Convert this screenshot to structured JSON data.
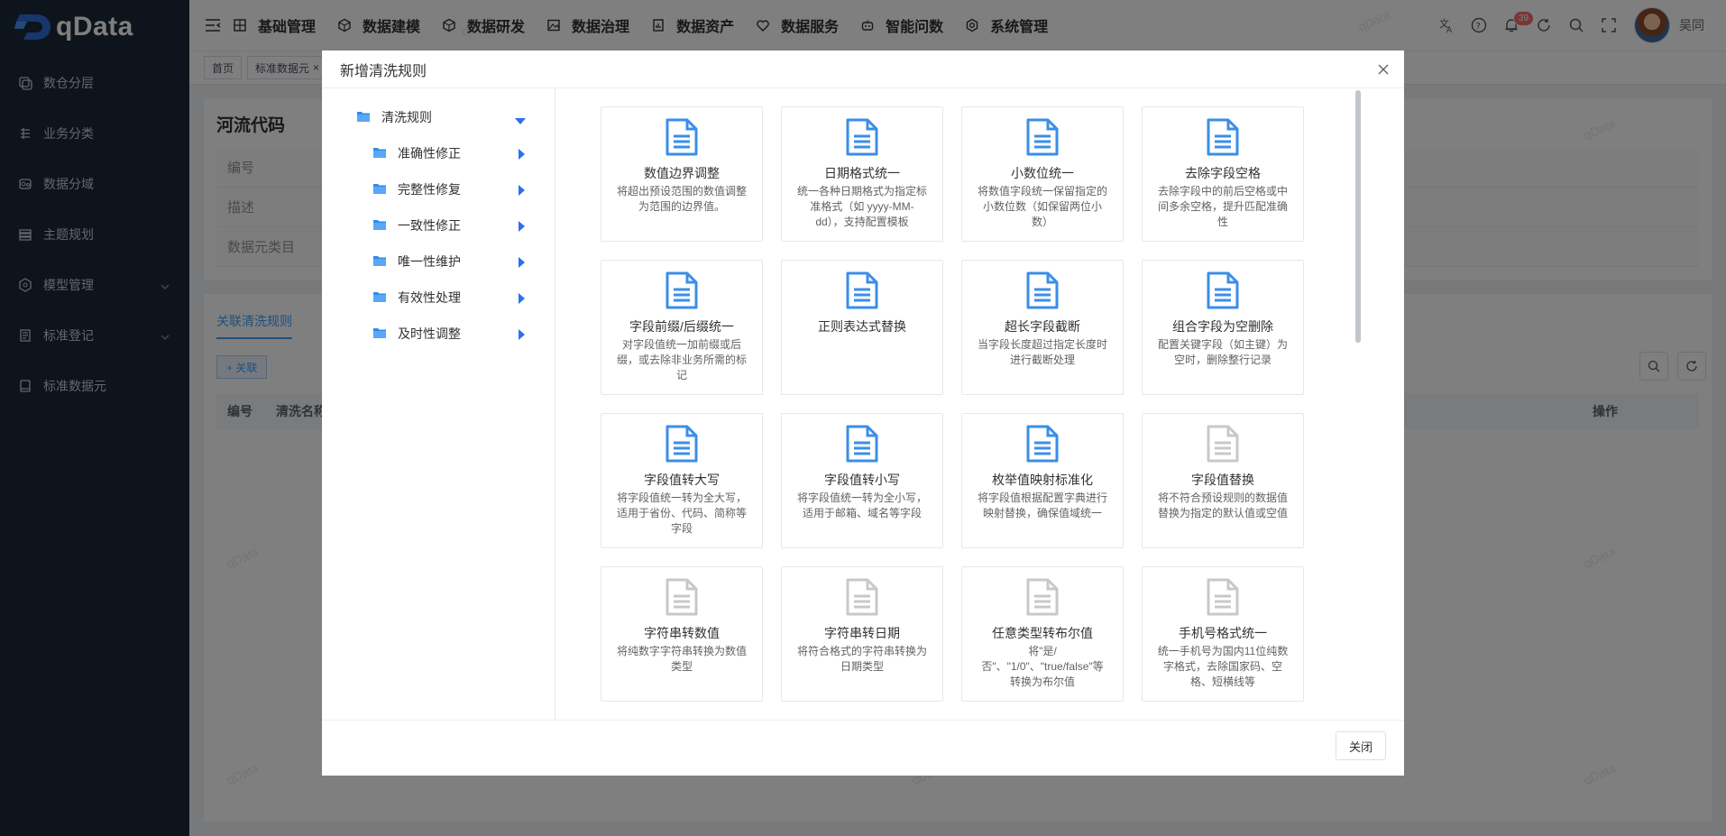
{
  "app": {
    "logo_text": "qData"
  },
  "sidebar": {
    "items": [
      {
        "label": "数仓分层",
        "icon": "layers-icon",
        "expandable": false
      },
      {
        "label": "业务分类",
        "icon": "list-icon",
        "expandable": false
      },
      {
        "label": "数据分域",
        "icon": "domain-icon",
        "expandable": false
      },
      {
        "label": "主题规划",
        "icon": "stack-icon",
        "expandable": false
      },
      {
        "label": "模型管理",
        "icon": "model-icon",
        "expandable": true
      },
      {
        "label": "标准登记",
        "icon": "register-icon",
        "expandable": true
      },
      {
        "label": "标准数据元",
        "icon": "dataelement-icon",
        "expandable": false
      }
    ]
  },
  "topbar": {
    "menu": [
      {
        "label": "基础管理",
        "icon": "grid-icon"
      },
      {
        "label": "数据建模",
        "icon": "cube-icon"
      },
      {
        "label": "数据研发",
        "icon": "cube-icon"
      },
      {
        "label": "数据治理",
        "icon": "image-icon"
      },
      {
        "label": "数据资产",
        "icon": "report-icon"
      },
      {
        "label": "数据服务",
        "icon": "heart-icon"
      },
      {
        "label": "智能问数",
        "icon": "robot-icon"
      },
      {
        "label": "系统管理",
        "icon": "settings-icon"
      }
    ],
    "notification_count": "39",
    "username": "吴同"
  },
  "tags": [
    {
      "label": "首页"
    },
    {
      "label": "标准数据元"
    }
  ],
  "background_page": {
    "title": "河流代码",
    "fields": [
      "编号",
      "描述",
      "数据元类目"
    ],
    "tab": "关联清洗规则",
    "add_button": "+ 关联",
    "columns": [
      "编号",
      "清洗名称",
      "操作"
    ]
  },
  "dialog": {
    "title": "新增清洗规则",
    "close_button": "关闭",
    "tree": {
      "root": "清洗规则",
      "children": [
        "准确性修正",
        "完整性修复",
        "一致性修正",
        "唯一性维护",
        "有效性处理",
        "及时性调整"
      ]
    },
    "cards": [
      {
        "title": "数值边界调整",
        "desc": "将超出预设范围的数值调整为范围的边界值。",
        "active": true
      },
      {
        "title": "日期格式统一",
        "desc": "统一各种日期格式为指定标准格式（如 yyyy-MM-dd），支持配置模板",
        "active": true
      },
      {
        "title": "小数位统一",
        "desc": "将数值字段统一保留指定的小数位数（如保留两位小数）",
        "active": true
      },
      {
        "title": "去除字段空格",
        "desc": "去除字段中的前后空格或中间多余空格，提升匹配准确性",
        "active": true
      },
      {
        "title": "字段前缀/后缀统一",
        "desc": "对字段值统一加前缀或后缀，或去除非业务所需的标记",
        "active": true
      },
      {
        "title": "正则表达式替换",
        "desc": "",
        "active": true
      },
      {
        "title": "超长字段截断",
        "desc": "当字段长度超过指定长度时进行截断处理",
        "active": true
      },
      {
        "title": "组合字段为空删除",
        "desc": "配置关键字段（如主键）为空时，删除整行记录",
        "active": true
      },
      {
        "title": "字段值转大写",
        "desc": "将字段值统一转为全大写，适用于省份、代码、简称等字段",
        "active": true
      },
      {
        "title": "字段值转小写",
        "desc": "将字段值统一转为全小写，适用于邮箱、域名等字段",
        "active": true
      },
      {
        "title": "枚举值映射标准化",
        "desc": "将字段值根据配置字典进行映射替换，确保值域统一",
        "active": true
      },
      {
        "title": "字段值替换",
        "desc": "将不符合预设规则的数据值替换为指定的默认值或空值",
        "active": false
      },
      {
        "title": "字符串转数值",
        "desc": "将纯数字字符串转换为数值类型",
        "active": false
      },
      {
        "title": "字符串转日期",
        "desc": "将符合格式的字符串转换为日期类型",
        "active": false
      },
      {
        "title": "任意类型转布尔值",
        "desc": "将\"是/否\"、\"1/0\"、\"true/false\"等转换为布尔值",
        "active": false
      },
      {
        "title": "手机号格式统一",
        "desc": "统一手机号为国内11位纯数字格式，去除国家码、空格、短横线等",
        "active": false
      }
    ]
  },
  "watermark": "qData",
  "colors": {
    "sidebar_bg": "#1d2939",
    "accent": "#409eff",
    "doc_active": "#3b8ee8",
    "doc_inactive": "#c8c8c8"
  }
}
